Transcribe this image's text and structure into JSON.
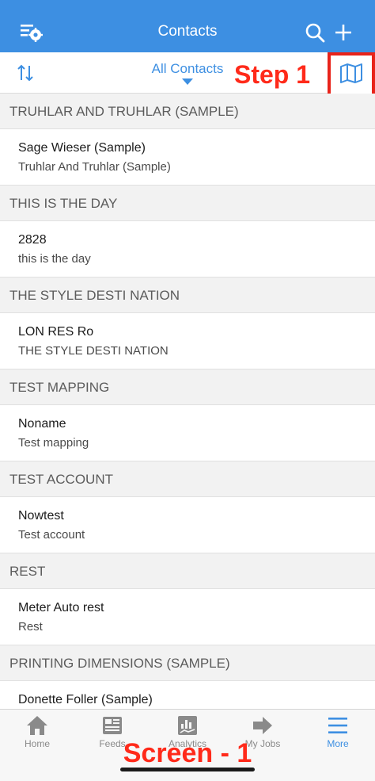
{
  "app": {
    "title": "Contacts"
  },
  "header_icons": {
    "settings": "list-settings-icon",
    "search": "search-icon",
    "add": "plus-icon"
  },
  "toolbar": {
    "sort_icon": "sort-arrows-icon",
    "filter_label": "All Contacts",
    "map_icon": "map-icon"
  },
  "annotations": {
    "step": "Step 1",
    "screen": "Screen - 1",
    "highlight_color": "#e8231a"
  },
  "sections": [
    {
      "header": "TRUHLAR AND TRUHLAR (SAMPLE)",
      "contacts": [
        {
          "name": "Sage Wieser (Sample)",
          "company": "Truhlar And Truhlar (Sample)"
        }
      ]
    },
    {
      "header": "THIS IS THE DAY",
      "contacts": [
        {
          "name": "2828",
          "company": "this is the day"
        }
      ]
    },
    {
      "header": "THE STYLE DESTI NATION",
      "contacts": [
        {
          "name": "LON RES Ro",
          "company": "THE STYLE DESTI NATION"
        }
      ]
    },
    {
      "header": "TEST MAPPING",
      "contacts": [
        {
          "name": "Noname",
          "company": "Test mapping"
        }
      ]
    },
    {
      "header": "TEST ACCOUNT",
      "contacts": [
        {
          "name": "Nowtest",
          "company": "Test account"
        }
      ]
    },
    {
      "header": "REST",
      "contacts": [
        {
          "name": "Meter Auto rest",
          "company": "Rest"
        }
      ]
    },
    {
      "header": "PRINTING DIMENSIONS (SAMPLE)",
      "contacts": [
        {
          "name": "Donette Foller (Sample)",
          "company": ""
        }
      ]
    }
  ],
  "tabbar": {
    "active": "More",
    "tabs": [
      {
        "label": "Home",
        "icon": "home-icon"
      },
      {
        "label": "Feeds",
        "icon": "newspaper-icon"
      },
      {
        "label": "Analytics",
        "icon": "analytics-icon"
      },
      {
        "label": "My Jobs",
        "icon": "arrow-right-icon"
      },
      {
        "label": "More",
        "icon": "hamburger-menu-icon"
      }
    ]
  },
  "colors": {
    "brand_blue": "#3d8fe2",
    "annotation_red": "#ff2a1a"
  }
}
